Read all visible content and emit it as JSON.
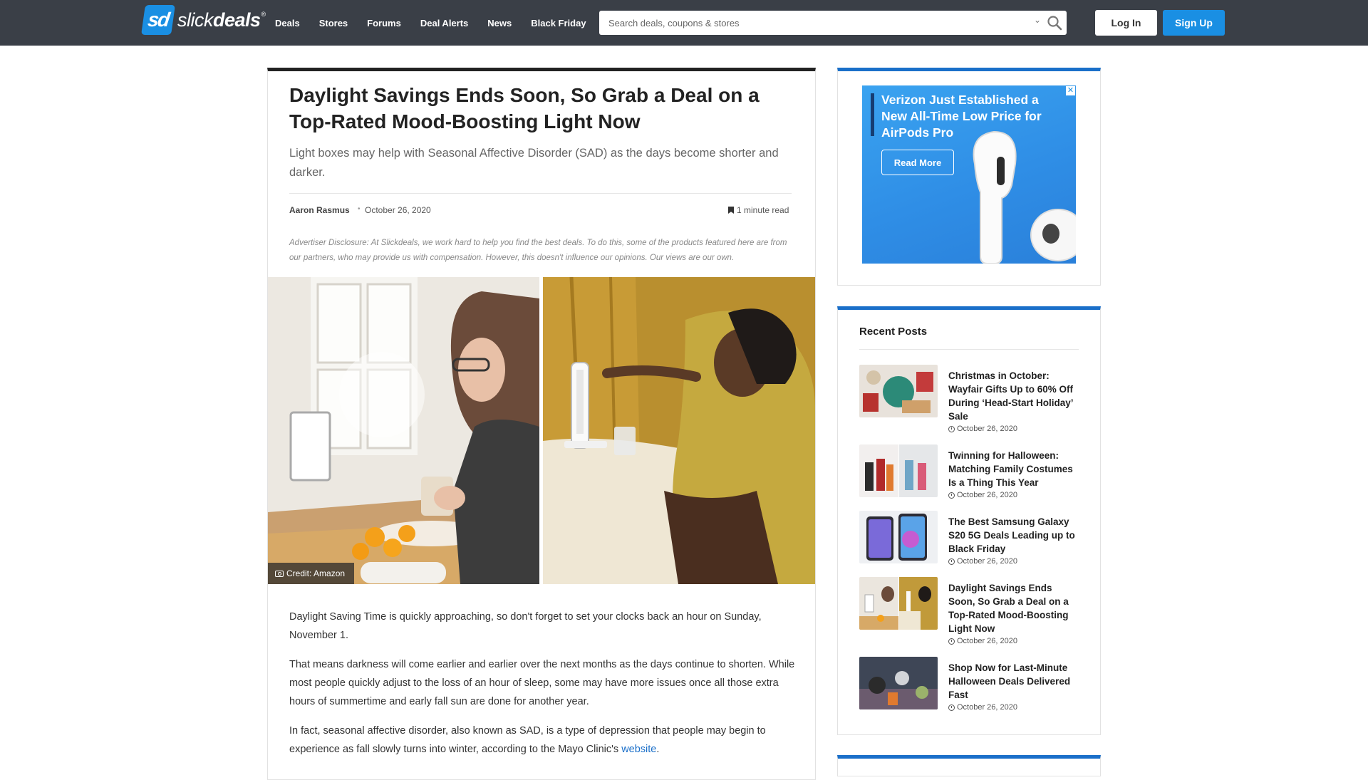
{
  "header": {
    "logo_mark": "sd",
    "logo_text_light": "slick",
    "logo_text_bold": "deals",
    "logo_reg": "®",
    "nav": [
      "Deals",
      "Stores",
      "Forums",
      "Deal Alerts",
      "News",
      "Black Friday"
    ],
    "search_placeholder": "Search deals, coupons & stores",
    "login_label": "Log In",
    "signup_label": "Sign Up",
    "accent": "#1a8fe3",
    "bar_color": "#3a3f47"
  },
  "article": {
    "title": "Daylight Savings Ends Soon, So Grab a Deal on a Top-Rated Mood-Boosting Light Now",
    "subtitle": "Light boxes may help with Seasonal Affective Disorder (SAD) as the days become shorter and darker.",
    "author": "Aaron Rasmus",
    "separator": "•",
    "date": "October 26, 2020",
    "read_time": "1 minute read",
    "disclosure": "Advertiser Disclosure: At Slickdeals, we work hard to help you find the best deals. To do this, some of the products featured here are from our partners, who may provide us with compensation. However, this doesn't influence our opinions. Our views are our own.",
    "image_credit": "Credit: Amazon",
    "paragraphs": [
      "Daylight Saving Time is quickly approaching, so don't forget to set your clocks back an hour on Sunday, November 1.",
      "That means darkness will come earlier and earlier over the next months as the days continue to shorten. While most people quickly adjust to the loss of an hour of sleep, some may have more issues once all those extra hours of summertime and early fall sun are done for another year.",
      "In fact, seasonal affective disorder, also known as SAD, is a type of depression that people may begin to experience as fall slowly turns into winter, according to the Mayo Clinic's"
    ],
    "link_text": "website",
    "link_after": "."
  },
  "ad": {
    "headline": "Verizon Just Established a New All-Time Low Price for AirPods Pro",
    "button": "Read More",
    "close": "✕"
  },
  "recent": {
    "title": "Recent Posts",
    "posts": [
      {
        "title": "Christmas in October: Wayfair Gifts Up to 60% Off During ‘Head-Start Holiday’ Sale",
        "date": "October 26, 2020"
      },
      {
        "title": "Twinning for Halloween: Matching Family Costumes Is a Thing This Year",
        "date": "October 26, 2020"
      },
      {
        "title": "The Best Samsung Galaxy S20 5G Deals Leading up to Black Friday",
        "date": "October 26, 2020"
      },
      {
        "title": "Daylight Savings Ends Soon, So Grab a Deal on a Top-Rated Mood-Boosting Light Now",
        "date": "October 26, 2020"
      },
      {
        "title": "Shop Now for Last-Minute Halloween Deals Delivered Fast",
        "date": "October 26, 2020"
      }
    ]
  }
}
